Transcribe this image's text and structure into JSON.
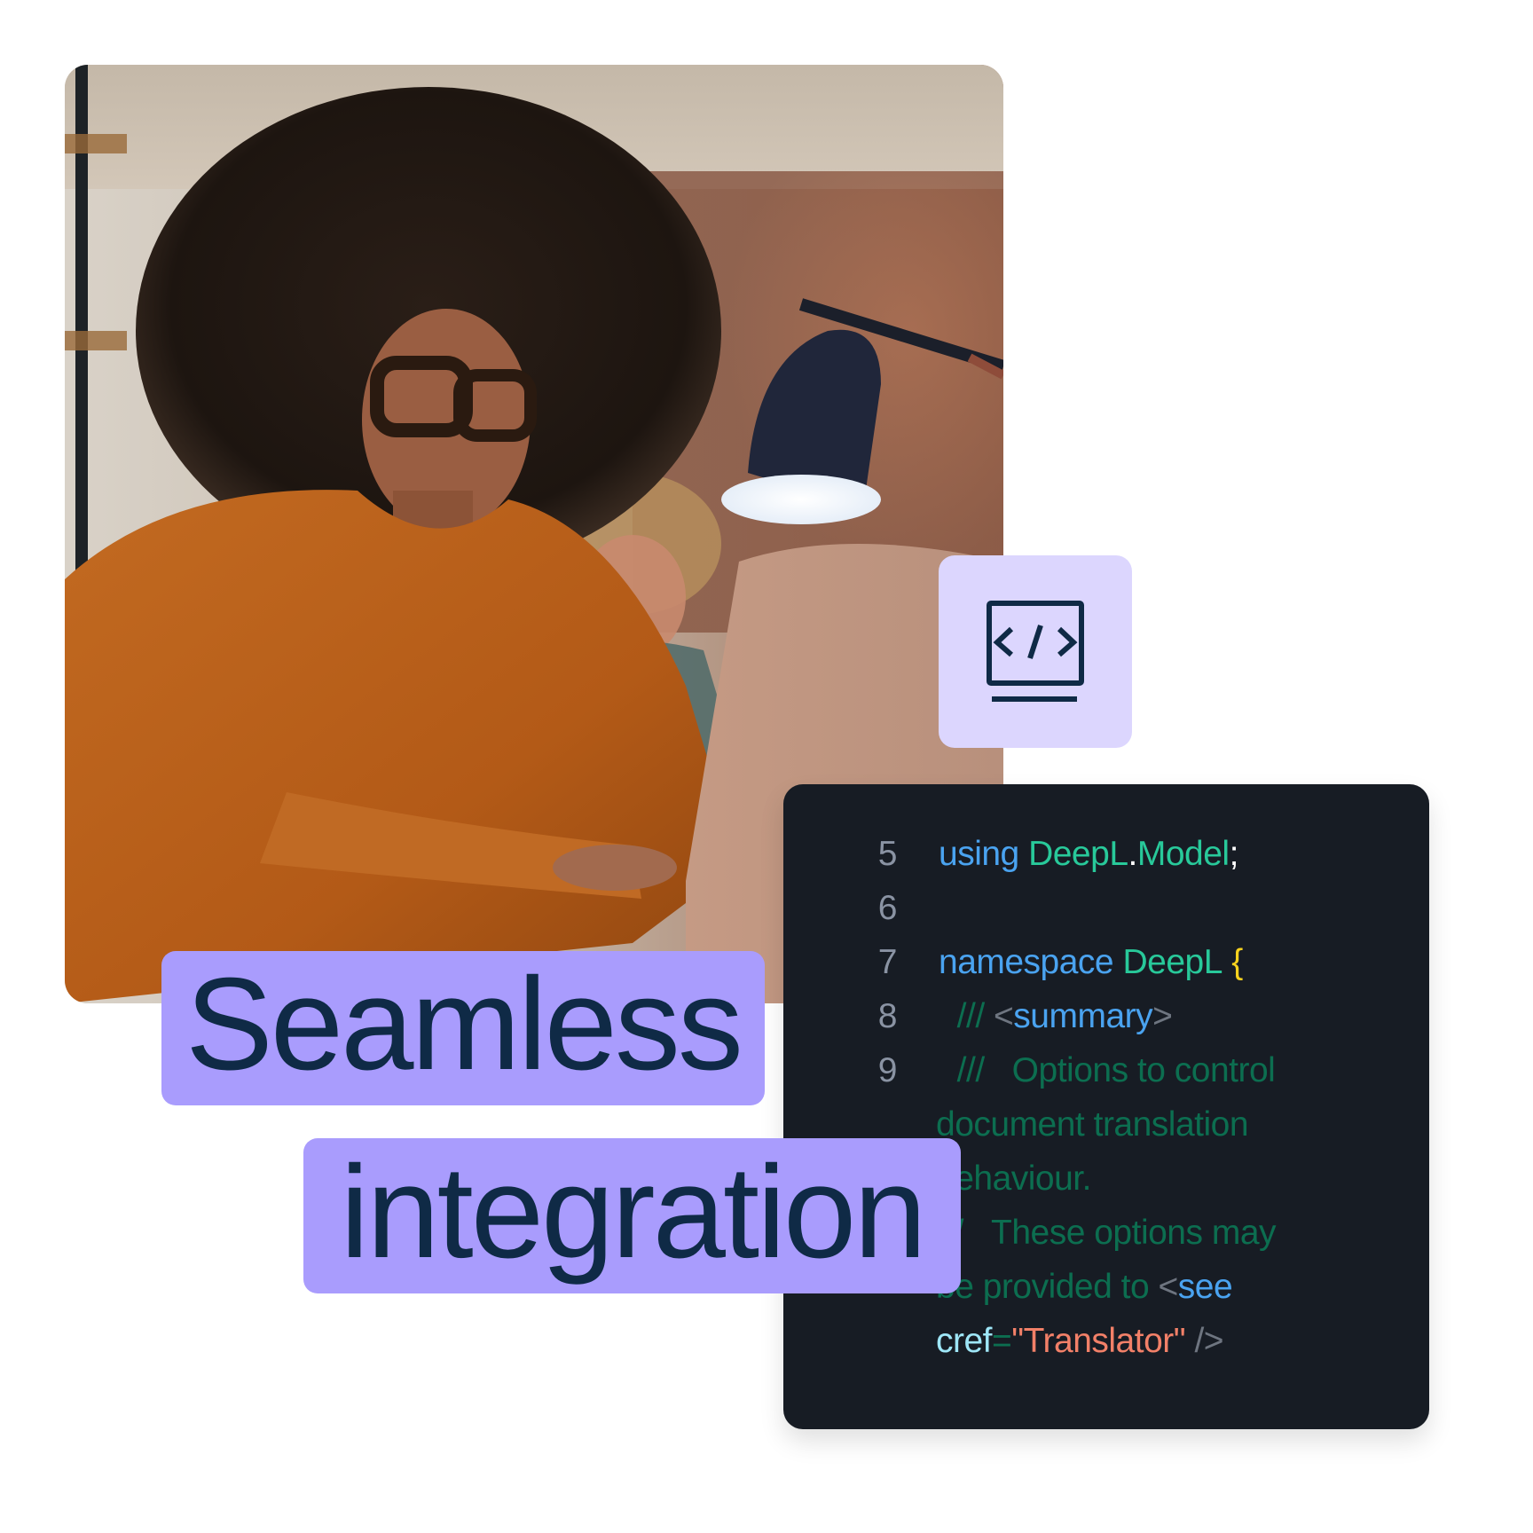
{
  "photo": {
    "description": "Woman with curly hair and glasses in an orange sweater working on a laptop under a desk lamp, colleague in background",
    "icon": "photo"
  },
  "icon_tile": {
    "icon": "code-monitor-icon",
    "background": "#dcd6fe",
    "glyph_color": "#0f2a46"
  },
  "headline": {
    "line1": "Seamless",
    "line2": "integration",
    "pill_color": "#a99cfd",
    "text_color": "#0f2a46"
  },
  "code": {
    "background": "#171c24",
    "lines": [
      {
        "number": "5",
        "tokens": [
          {
            "t": "using ",
            "c": "kw"
          },
          {
            "t": "DeepL",
            "c": "ns"
          },
          {
            "t": ".",
            "c": "pun"
          },
          {
            "t": "Model",
            "c": "ns"
          },
          {
            "t": ";",
            "c": "pun"
          }
        ]
      },
      {
        "number": "6",
        "tokens": []
      },
      {
        "number": "7",
        "tokens": [
          {
            "t": "namespace ",
            "c": "kw"
          },
          {
            "t": "DeepL ",
            "c": "ns"
          },
          {
            "t": "{",
            "c": "brace"
          }
        ]
      },
      {
        "number": "8",
        "tokens": [
          {
            "t": "  /// ",
            "c": "com"
          },
          {
            "t": "<",
            "c": "tag"
          },
          {
            "t": "summary",
            "c": "tagn"
          },
          {
            "t": ">",
            "c": "tag"
          }
        ]
      },
      {
        "number": "9",
        "tokens": [
          {
            "t": "  ///   Options to control",
            "c": "com"
          }
        ]
      },
      {
        "number": "",
        "tokens": [
          {
            "t": "document translation",
            "c": "com"
          }
        ]
      },
      {
        "number": "",
        "tokens": [
          {
            "t": "behaviour.",
            "c": "com"
          }
        ]
      },
      {
        "number": "",
        "tokens": [
          {
            "t": "///   These options may",
            "c": "com"
          }
        ]
      },
      {
        "number": "",
        "tokens": [
          {
            "t": "be provided to ",
            "c": "com"
          },
          {
            "t": "<",
            "c": "tag"
          },
          {
            "t": "see",
            "c": "tagn"
          }
        ]
      },
      {
        "number": "",
        "tokens": [
          {
            "t": "cref",
            "c": "attr"
          },
          {
            "t": "=",
            "c": "com"
          },
          {
            "t": "\"Translator\"",
            "c": "str"
          },
          {
            "t": " />",
            "c": "tag"
          }
        ]
      }
    ],
    "colors": {
      "kw": "#4aa3f0",
      "ns": "#28c99a",
      "pun": "#ffffff",
      "brace": "#f7d21e",
      "com": "#0c6e50",
      "tag": "#6e7580",
      "tagn": "#4aa3f0",
      "attr": "#9ee6f7",
      "str": "#f28068",
      "line_number": "#8a93a3"
    }
  }
}
